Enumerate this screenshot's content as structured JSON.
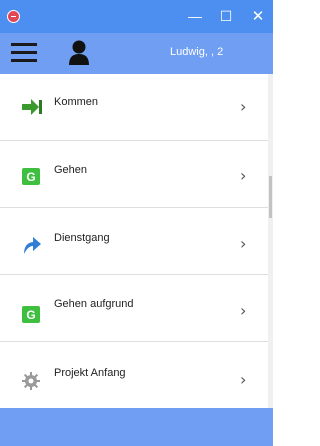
{
  "window": {
    "minimize_label": "—",
    "maximize_label": "☐",
    "close_label": "✕"
  },
  "header": {
    "menu_icon": "hamburger-menu-icon",
    "user_icon": "user-silhouette-icon",
    "user_name": "Ludwig, , 2"
  },
  "menu": {
    "items": [
      {
        "label": "Kommen",
        "icon": "arrow-in-icon",
        "chevron": "›"
      },
      {
        "label": "Gehen",
        "icon": "g-badge-icon",
        "chevron": "›"
      },
      {
        "label": "Dienstgang",
        "icon": "curved-arrow-icon",
        "chevron": "›"
      },
      {
        "label": "Gehen aufgrund",
        "icon": "g-badge-icon",
        "chevron": "›"
      },
      {
        "label": "Projekt Anfang",
        "icon": "gear-icon",
        "chevron": "›"
      }
    ]
  },
  "colors": {
    "titlebar": "#4d8ff0",
    "header": "#6f9ef3",
    "footer": "#6f9ef3",
    "arrow_green": "#3a9a2e",
    "badge_green": "#3fbf3f",
    "dienstgang_blue": "#2f7fd6"
  }
}
